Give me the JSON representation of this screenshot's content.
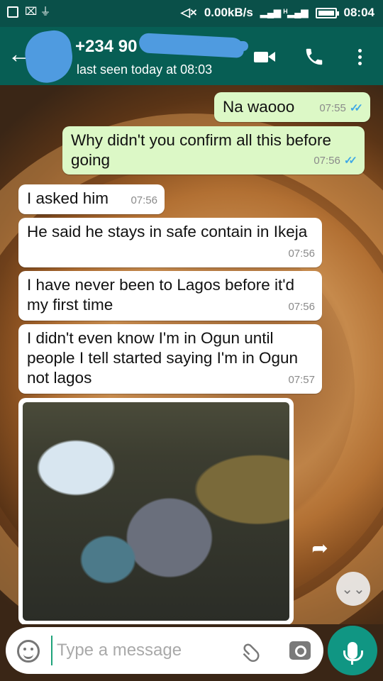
{
  "status_bar": {
    "notification_glyphs": "⌧ ⏚",
    "mute_glyph": "◁×",
    "net_speed": "0.00kB/s",
    "signal": "▂▄▆ ᴴ▂▄▆",
    "time": "08:04"
  },
  "header": {
    "back_glyph": "←",
    "contact_name": "+234 90",
    "contact_status": "last seen today at 08:03"
  },
  "messages": [
    {
      "text": "Na waooo",
      "time": "07:55",
      "ticks": "✓✓"
    },
    {
      "text": "Why didn't you confirm all this before going",
      "time": "07:56",
      "ticks": "✓✓"
    },
    {
      "text": "I asked him",
      "time": "07:56"
    },
    {
      "text": "He said he stays in safe contain in Ikeja",
      "time": "07:56"
    },
    {
      "text": "I have never been to Lagos before it'd my first time",
      "time": "07:56"
    },
    {
      "text": "I didn't even know I'm in Ogun until people I tell started saying I'm in Ogun not lagos",
      "time": "07:57"
    }
  ],
  "icons": {
    "share": "➦",
    "scroll_down": "⌄⌄",
    "attach": "📎"
  },
  "input": {
    "placeholder": "Type a message"
  },
  "colors": {
    "header": "#075e54",
    "status_bar": "#0a5049",
    "sent_bubble": "#dcf8c6",
    "received_bubble": "#ffffff",
    "read_ticks": "#3fa8e6",
    "mic_button": "#109683"
  }
}
